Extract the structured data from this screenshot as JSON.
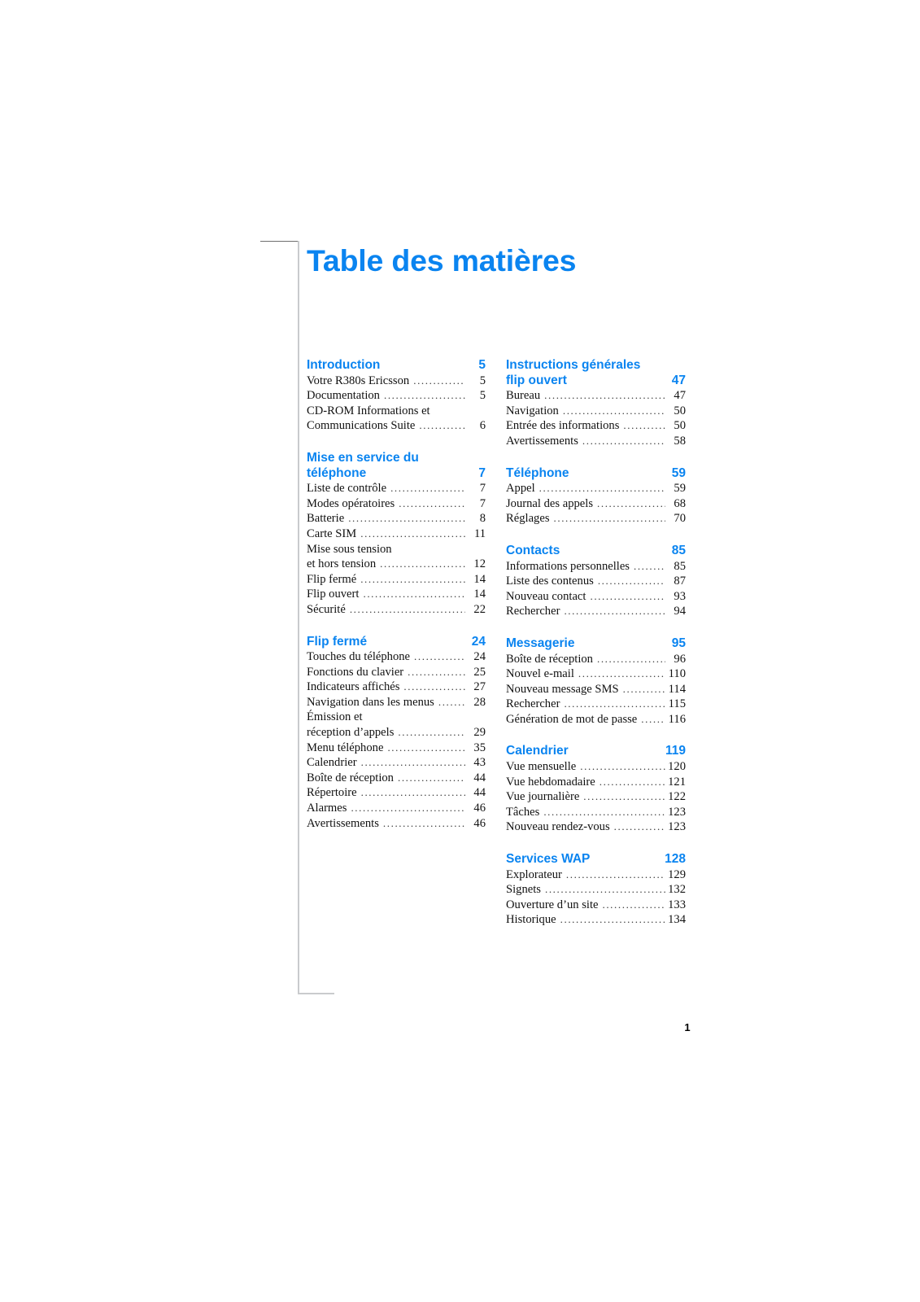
{
  "document": {
    "title": "Table des matières",
    "folio": "1",
    "accent_color": "#0a84f0",
    "text_color": "#111111"
  },
  "toc": {
    "left_column": [
      {
        "heading": "Introduction",
        "heading_lines": [
          "Introduction"
        ],
        "page": "5",
        "entries": [
          {
            "label": "Votre R380s Ericsson",
            "page": "5"
          },
          {
            "label": "Documentation",
            "page": "5"
          },
          {
            "label": "CD-ROM Informations et",
            "page": "",
            "continuation": true
          },
          {
            "label": "Communications Suite",
            "page": "6"
          }
        ]
      },
      {
        "heading": "Mise en service du téléphone",
        "heading_lines": [
          "Mise en service du",
          "téléphone"
        ],
        "page": "7",
        "entries": [
          {
            "label": "Liste de contrôle",
            "page": "7"
          },
          {
            "label": "Modes opératoires",
            "page": "7"
          },
          {
            "label": "Batterie",
            "page": "8"
          },
          {
            "label": "Carte SIM",
            "page": "11"
          },
          {
            "label": "Mise sous tension",
            "page": "",
            "continuation": true
          },
          {
            "label": "et hors tension",
            "page": "12"
          },
          {
            "label": "Flip fermé",
            "page": "14"
          },
          {
            "label": "Flip ouvert",
            "page": "14"
          },
          {
            "label": "Sécurité",
            "page": "22"
          }
        ]
      },
      {
        "heading": "Flip fermé",
        "heading_lines": [
          "Flip fermé"
        ],
        "page": "24",
        "entries": [
          {
            "label": "Touches du téléphone",
            "page": "24"
          },
          {
            "label": "Fonctions du clavier",
            "page": "25"
          },
          {
            "label": "Indicateurs affichés",
            "page": "27"
          },
          {
            "label": "Navigation dans les menus",
            "page": "28"
          },
          {
            "label": "Émission et",
            "page": "",
            "continuation": true
          },
          {
            "label": "réception d’appels",
            "page": "29"
          },
          {
            "label": "Menu téléphone",
            "page": "35"
          },
          {
            "label": "Calendrier",
            "page": "43"
          },
          {
            "label": "Boîte de réception",
            "page": "44"
          },
          {
            "label": "Répertoire",
            "page": "44"
          },
          {
            "label": "Alarmes",
            "page": "46"
          },
          {
            "label": "Avertissements",
            "page": "46"
          }
        ]
      }
    ],
    "right_column": [
      {
        "heading": "Instructions générales flip ouvert",
        "heading_lines": [
          "Instructions générales",
          "flip ouvert"
        ],
        "page": "47",
        "entries": [
          {
            "label": "Bureau",
            "page": "47"
          },
          {
            "label": "Navigation",
            "page": "50"
          },
          {
            "label": "Entrée des informations",
            "page": "50"
          },
          {
            "label": "Avertissements",
            "page": "58"
          }
        ]
      },
      {
        "heading": "Téléphone",
        "heading_lines": [
          "Téléphone"
        ],
        "page": "59",
        "entries": [
          {
            "label": "Appel",
            "page": "59"
          },
          {
            "label": "Journal des appels",
            "page": "68"
          },
          {
            "label": "Réglages",
            "page": "70"
          }
        ]
      },
      {
        "heading": "Contacts",
        "heading_lines": [
          "Contacts"
        ],
        "page": "85",
        "entries": [
          {
            "label": "Informations personnelles",
            "page": "85"
          },
          {
            "label": "Liste des contenus",
            "page": "87"
          },
          {
            "label": "Nouveau contact",
            "page": "93"
          },
          {
            "label": "Rechercher",
            "page": "94"
          }
        ]
      },
      {
        "heading": "Messagerie",
        "heading_lines": [
          "Messagerie"
        ],
        "page": "95",
        "entries": [
          {
            "label": "Boîte de réception",
            "page": "96"
          },
          {
            "label": "Nouvel e-mail",
            "page": "110"
          },
          {
            "label": "Nouveau message SMS",
            "page": "114"
          },
          {
            "label": "Rechercher",
            "page": "115"
          },
          {
            "label": "Génération de mot de passe",
            "page": "116"
          }
        ]
      },
      {
        "heading": "Calendrier",
        "heading_lines": [
          "Calendrier"
        ],
        "page": "119",
        "entries": [
          {
            "label": "Vue mensuelle",
            "page": "120"
          },
          {
            "label": "Vue hebdomadaire",
            "page": "121"
          },
          {
            "label": "Vue journalière",
            "page": "122"
          },
          {
            "label": "Tâches",
            "page": "123"
          },
          {
            "label": "Nouveau rendez-vous",
            "page": "123"
          }
        ]
      },
      {
        "heading": "Services WAP",
        "heading_lines": [
          "Services WAP"
        ],
        "page": "128",
        "entries": [
          {
            "label": "Explorateur",
            "page": "129"
          },
          {
            "label": "Signets",
            "page": "132"
          },
          {
            "label": "Ouverture d’un site",
            "page": "133"
          },
          {
            "label": "Historique",
            "page": "134"
          }
        ]
      }
    ]
  }
}
